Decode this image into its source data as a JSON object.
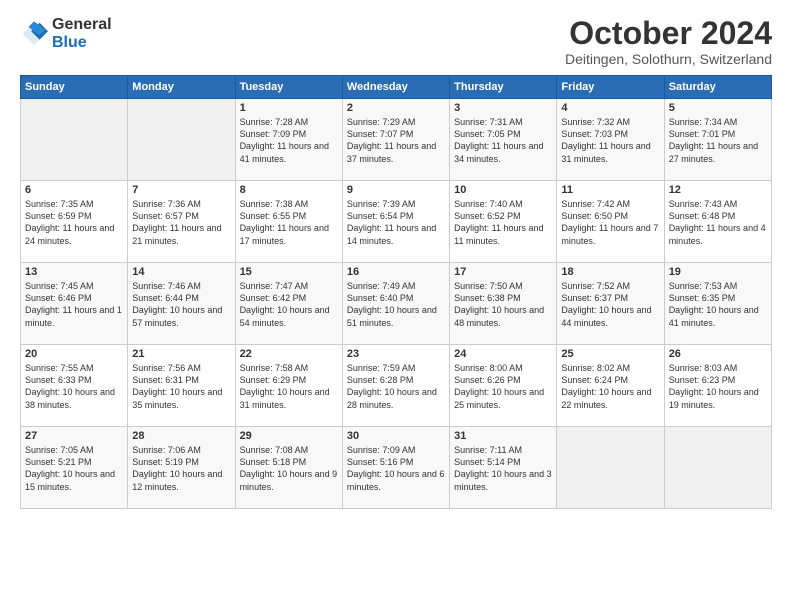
{
  "logo": {
    "general": "General",
    "blue": "Blue"
  },
  "title": "October 2024",
  "location": "Deitingen, Solothurn, Switzerland",
  "days_of_week": [
    "Sunday",
    "Monday",
    "Tuesday",
    "Wednesday",
    "Thursday",
    "Friday",
    "Saturday"
  ],
  "weeks": [
    [
      {
        "day": "",
        "info": ""
      },
      {
        "day": "",
        "info": ""
      },
      {
        "day": "1",
        "info": "Sunrise: 7:28 AM\nSunset: 7:09 PM\nDaylight: 11 hours and 41 minutes."
      },
      {
        "day": "2",
        "info": "Sunrise: 7:29 AM\nSunset: 7:07 PM\nDaylight: 11 hours and 37 minutes."
      },
      {
        "day": "3",
        "info": "Sunrise: 7:31 AM\nSunset: 7:05 PM\nDaylight: 11 hours and 34 minutes."
      },
      {
        "day": "4",
        "info": "Sunrise: 7:32 AM\nSunset: 7:03 PM\nDaylight: 11 hours and 31 minutes."
      },
      {
        "day": "5",
        "info": "Sunrise: 7:34 AM\nSunset: 7:01 PM\nDaylight: 11 hours and 27 minutes."
      }
    ],
    [
      {
        "day": "6",
        "info": "Sunrise: 7:35 AM\nSunset: 6:59 PM\nDaylight: 11 hours and 24 minutes."
      },
      {
        "day": "7",
        "info": "Sunrise: 7:36 AM\nSunset: 6:57 PM\nDaylight: 11 hours and 21 minutes."
      },
      {
        "day": "8",
        "info": "Sunrise: 7:38 AM\nSunset: 6:55 PM\nDaylight: 11 hours and 17 minutes."
      },
      {
        "day": "9",
        "info": "Sunrise: 7:39 AM\nSunset: 6:54 PM\nDaylight: 11 hours and 14 minutes."
      },
      {
        "day": "10",
        "info": "Sunrise: 7:40 AM\nSunset: 6:52 PM\nDaylight: 11 hours and 11 minutes."
      },
      {
        "day": "11",
        "info": "Sunrise: 7:42 AM\nSunset: 6:50 PM\nDaylight: 11 hours and 7 minutes."
      },
      {
        "day": "12",
        "info": "Sunrise: 7:43 AM\nSunset: 6:48 PM\nDaylight: 11 hours and 4 minutes."
      }
    ],
    [
      {
        "day": "13",
        "info": "Sunrise: 7:45 AM\nSunset: 6:46 PM\nDaylight: 11 hours and 1 minute."
      },
      {
        "day": "14",
        "info": "Sunrise: 7:46 AM\nSunset: 6:44 PM\nDaylight: 10 hours and 57 minutes."
      },
      {
        "day": "15",
        "info": "Sunrise: 7:47 AM\nSunset: 6:42 PM\nDaylight: 10 hours and 54 minutes."
      },
      {
        "day": "16",
        "info": "Sunrise: 7:49 AM\nSunset: 6:40 PM\nDaylight: 10 hours and 51 minutes."
      },
      {
        "day": "17",
        "info": "Sunrise: 7:50 AM\nSunset: 6:38 PM\nDaylight: 10 hours and 48 minutes."
      },
      {
        "day": "18",
        "info": "Sunrise: 7:52 AM\nSunset: 6:37 PM\nDaylight: 10 hours and 44 minutes."
      },
      {
        "day": "19",
        "info": "Sunrise: 7:53 AM\nSunset: 6:35 PM\nDaylight: 10 hours and 41 minutes."
      }
    ],
    [
      {
        "day": "20",
        "info": "Sunrise: 7:55 AM\nSunset: 6:33 PM\nDaylight: 10 hours and 38 minutes."
      },
      {
        "day": "21",
        "info": "Sunrise: 7:56 AM\nSunset: 6:31 PM\nDaylight: 10 hours and 35 minutes."
      },
      {
        "day": "22",
        "info": "Sunrise: 7:58 AM\nSunset: 6:29 PM\nDaylight: 10 hours and 31 minutes."
      },
      {
        "day": "23",
        "info": "Sunrise: 7:59 AM\nSunset: 6:28 PM\nDaylight: 10 hours and 28 minutes."
      },
      {
        "day": "24",
        "info": "Sunrise: 8:00 AM\nSunset: 6:26 PM\nDaylight: 10 hours and 25 minutes."
      },
      {
        "day": "25",
        "info": "Sunrise: 8:02 AM\nSunset: 6:24 PM\nDaylight: 10 hours and 22 minutes."
      },
      {
        "day": "26",
        "info": "Sunrise: 8:03 AM\nSunset: 6:23 PM\nDaylight: 10 hours and 19 minutes."
      }
    ],
    [
      {
        "day": "27",
        "info": "Sunrise: 7:05 AM\nSunset: 5:21 PM\nDaylight: 10 hours and 15 minutes."
      },
      {
        "day": "28",
        "info": "Sunrise: 7:06 AM\nSunset: 5:19 PM\nDaylight: 10 hours and 12 minutes."
      },
      {
        "day": "29",
        "info": "Sunrise: 7:08 AM\nSunset: 5:18 PM\nDaylight: 10 hours and 9 minutes."
      },
      {
        "day": "30",
        "info": "Sunrise: 7:09 AM\nSunset: 5:16 PM\nDaylight: 10 hours and 6 minutes."
      },
      {
        "day": "31",
        "info": "Sunrise: 7:11 AM\nSunset: 5:14 PM\nDaylight: 10 hours and 3 minutes."
      },
      {
        "day": "",
        "info": ""
      },
      {
        "day": "",
        "info": ""
      }
    ]
  ]
}
